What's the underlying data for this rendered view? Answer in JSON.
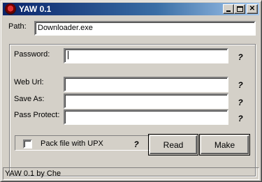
{
  "window": {
    "title": "YAW 0.1",
    "icon": "app-icon"
  },
  "path": {
    "label": "Path:",
    "value": "Downloader.exe"
  },
  "fields": {
    "password_label": "Password:",
    "password_value": "",
    "web_url_label": "Web Url:",
    "web_url_value": "",
    "save_as_label": "Save As:",
    "save_as_value": "",
    "pass_protect_label": "Pass Protect:",
    "pass_protect_value": ""
  },
  "help_glyph": "?",
  "upx": {
    "label": "Pack file with UPX",
    "checked": false
  },
  "buttons": {
    "read_label": "Read",
    "make_label": "Make"
  },
  "status": {
    "text": "YAW 0.1 by Che"
  }
}
